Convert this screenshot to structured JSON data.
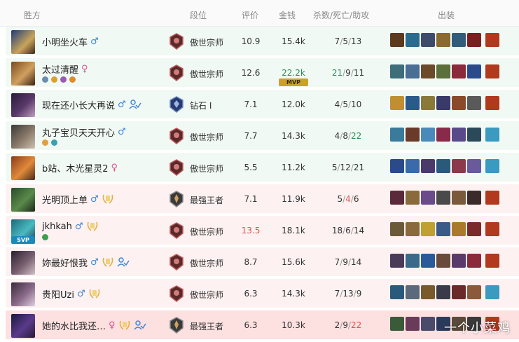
{
  "header": {
    "col_team": "胜方",
    "col_rank": "段位",
    "col_score": "评价",
    "col_gold": "金钱",
    "col_kda": "杀数/死亡/助攻",
    "col_items": "出装"
  },
  "colors": {
    "win_bg": "#f1f9f4",
    "loss_bg": "#fdf1f1",
    "highlight_bg": "#fde0e0",
    "male": "#3a86d8",
    "female": "#e0508f",
    "good": "#2e8b57",
    "bad": "#e05252"
  },
  "players": [
    {
      "name": "小明坐火车",
      "gender": "♂",
      "rank": "傲世宗师",
      "score": "10.9",
      "gold": "15.4k",
      "kills": "7",
      "deaths": "5",
      "assists": "13"
    },
    {
      "name": "太过清醒",
      "gender": "♀",
      "mvp": "MVP",
      "rank": "傲世宗师",
      "score": "12.6",
      "gold": "22.2k",
      "kills": "21",
      "deaths": "9",
      "assists": "11"
    },
    {
      "name": "现在还小长大再说",
      "gender": "♂",
      "rank": "钻石 Ⅰ",
      "score": "7.1",
      "gold": "12.0k",
      "kills": "4",
      "deaths": "5",
      "assists": "10"
    },
    {
      "name": "丸子宝贝天天开心",
      "gender": "♂",
      "rank": "傲世宗师",
      "score": "7.7",
      "gold": "14.3k",
      "kills": "4",
      "deaths": "8",
      "assists": "22"
    },
    {
      "name": "b站、木光星灵2",
      "gender": "♀",
      "rank": "傲世宗师",
      "score": "5.5",
      "gold": "11.2k",
      "kills": "5",
      "deaths": "12",
      "assists": "21"
    },
    {
      "name": "光明顶上单",
      "gender": "♂",
      "rank": "最强王者",
      "score": "7.1",
      "gold": "11.9k",
      "kills": "5",
      "deaths": "4",
      "assists": "6"
    },
    {
      "name": "jkhkah",
      "gender": "♂",
      "mvp": "SVP",
      "rank": "傲世宗师",
      "score": "13.5",
      "gold": "18.1k",
      "kills": "18",
      "deaths": "6",
      "assists": "14"
    },
    {
      "name": "妳最好恨我",
      "gender": "♂",
      "rank": "傲世宗师",
      "score": "8.7",
      "gold": "15.6k",
      "kills": "7",
      "deaths": "9",
      "assists": "14"
    },
    {
      "name": "贵阳Uzi",
      "gender": "♂",
      "rank": "傲世宗师",
      "score": "6.3",
      "gold": "14.3k",
      "kills": "7",
      "deaths": "13",
      "assists": "9"
    },
    {
      "name": "她的水比我还…",
      "gender": "♀",
      "rank": "最强王者",
      "score": "6.3",
      "gold": "10.3k",
      "kills": "2",
      "deaths": "9",
      "assists": "22"
    }
  ],
  "watermark": "一个小菜鸡"
}
